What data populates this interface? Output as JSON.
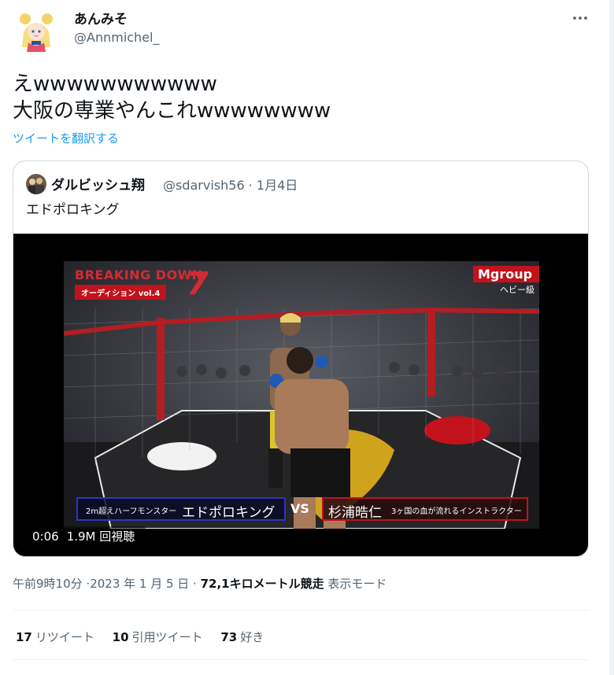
{
  "author": {
    "display_name": "あんみそ",
    "handle": "@Annmichel_",
    "avatar_icon": "anime-character-avatar-icon"
  },
  "tweet": {
    "lines": [
      "えwwwwwwwwwww",
      "大阪の専業やんこれwwwwwwww"
    ],
    "translate_label": "ツイートを翻訳する"
  },
  "quoted": {
    "display_name": "ダルビッシュ翔",
    "handle": "@sdarvish56",
    "separator": "·",
    "date": "1月4日",
    "text": "エドポロキング",
    "video": {
      "elapsed": "0:06",
      "views": "1.9M 回視聴",
      "overlay": {
        "show_title": "BREAKING DOWN",
        "show_number": "7",
        "show_subtitle": "オーディション vol.4",
        "sponsor": "Mgroup",
        "weight_class": "ヘビー級",
        "left_desc": "2m超えハーフモンスター",
        "left_name": "エドポロキング",
        "vs": "VS",
        "right_name": "杉浦晧仁",
        "right_desc": "3ヶ国の血が流れるインストラクター"
      }
    }
  },
  "meta": {
    "time": "午前9時10分",
    "date": "·2023 年 1 月 5 日 ·",
    "source": "72,1キロメートル競走",
    "mode": "表示モード"
  },
  "stats": [
    {
      "count": "17",
      "label": "リツイート"
    },
    {
      "count": "10",
      "label": "引用ツイート"
    },
    {
      "count": "73",
      "label": "好き"
    }
  ],
  "colors": {
    "link": "#1d9bf0",
    "secondary_text": "#536471",
    "border": "#cfd9de",
    "brand_red": "#c2121c"
  }
}
